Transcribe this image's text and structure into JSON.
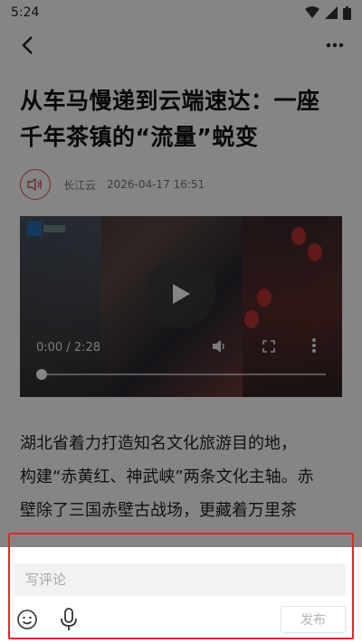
{
  "status_bar": {
    "time": "5:24"
  },
  "nav": {
    "back_icon": "back-arrow-icon",
    "more_icon": "more-horizontal-icon"
  },
  "article": {
    "title_line1": "从车马慢递到云端速达：一座",
    "title_line2": "千年茶镇的“流量”蜕变",
    "source": "长江云",
    "datetime": "2026-04-17 16:51",
    "body_line1": "湖北省着力打造知名文化旅游目的地，",
    "body_line2": "构建“赤黄红、神武峡”两条文化主轴。赤",
    "body_line3": "壁除了三国赤壁古战场，更藏着万里茶"
  },
  "video": {
    "time_display": "0:00 / 2:28",
    "progress": 0.0
  },
  "comment": {
    "placeholder": "写评论",
    "publish_label": "发布"
  },
  "colors": {
    "highlight": "#e0282a",
    "accent_red": "#d9534f"
  }
}
